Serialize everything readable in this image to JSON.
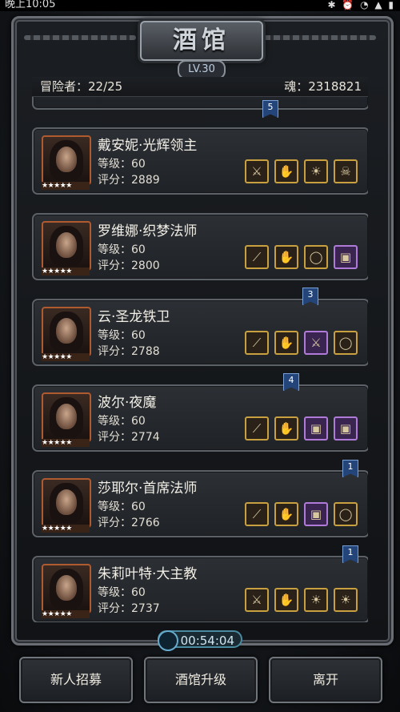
{
  "status": {
    "time": "晚上10:05"
  },
  "header": {
    "title": "酒馆",
    "level": "LV.30"
  },
  "info": {
    "adventurers": "冒险者：22/25",
    "soul": "魂：2318821"
  },
  "heroes": [
    {
      "name": "戴安妮·光辉领主",
      "level": "等级：60",
      "score": "评分：2889",
      "stars": "★★★★★",
      "equips": [
        {
          "icon": "⚔",
          "purple": false
        },
        {
          "icon": "✋",
          "purple": false
        },
        {
          "icon": "☀",
          "purple": false
        },
        {
          "icon": "☠",
          "purple": false
        }
      ]
    },
    {
      "name": "罗维娜·织梦法师",
      "level": "等级：60",
      "score": "评分：2800",
      "stars": "★★★★★",
      "equips": [
        {
          "icon": "⟋",
          "purple": false
        },
        {
          "icon": "✋",
          "purple": false
        },
        {
          "icon": "◯",
          "purple": false
        },
        {
          "icon": "▣",
          "purple": true
        }
      ]
    },
    {
      "name": "云·圣龙铁卫",
      "level": "等级：60",
      "score": "评分：2788",
      "stars": "★★★★★",
      "equips": [
        {
          "icon": "⟋",
          "purple": false
        },
        {
          "icon": "✋",
          "purple": false
        },
        {
          "icon": "⚔",
          "purple": true
        },
        {
          "icon": "◯",
          "purple": false
        }
      ]
    },
    {
      "name": "波尔·夜魔",
      "level": "等级：60",
      "score": "评分：2774",
      "stars": "★★★★★",
      "equips": [
        {
          "icon": "⟋",
          "purple": false
        },
        {
          "icon": "✋",
          "purple": false
        },
        {
          "icon": "▣",
          "purple": true
        },
        {
          "icon": "▣",
          "purple": true
        }
      ]
    },
    {
      "name": "莎耶尔·首席法师",
      "level": "等级：60",
      "score": "评分：2766",
      "stars": "★★★★★",
      "equips": [
        {
          "icon": "⟋",
          "purple": false
        },
        {
          "icon": "✋",
          "purple": false
        },
        {
          "icon": "▣",
          "purple": true
        },
        {
          "icon": "◯",
          "purple": false
        }
      ]
    },
    {
      "name": "朱莉叶特·大主教",
      "level": "等级：60",
      "score": "评分：2737",
      "stars": "★★★★★",
      "equips": [
        {
          "icon": "⚔",
          "purple": false
        },
        {
          "icon": "✋",
          "purple": false
        },
        {
          "icon": "☀",
          "purple": false
        },
        {
          "icon": "☀",
          "purple": false
        }
      ]
    }
  ],
  "ribbons": [
    "5",
    "3",
    "4",
    "1",
    "1"
  ],
  "timer": "00:54:04",
  "buttons": {
    "recruit": "新人招募",
    "upgrade": "酒馆升级",
    "leave": "离开"
  }
}
